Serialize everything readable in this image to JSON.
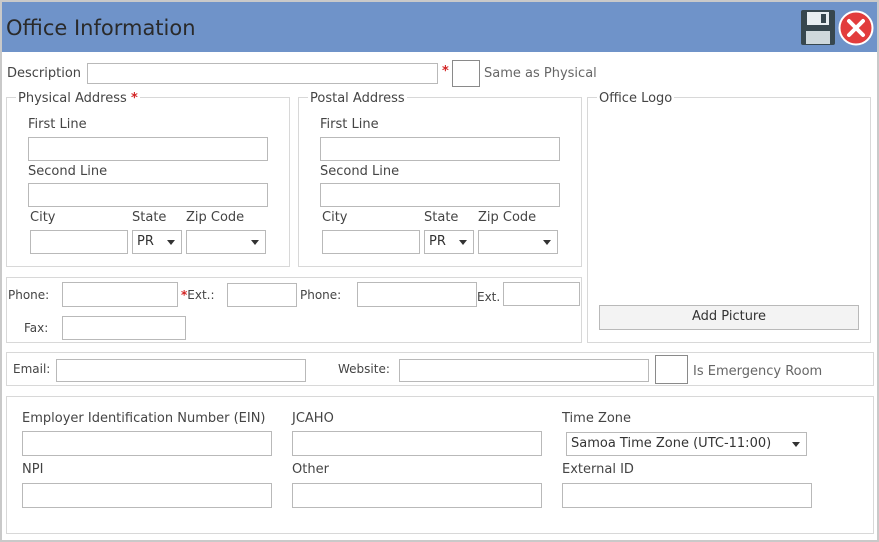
{
  "window": {
    "title": "Office Information"
  },
  "toolbar": {
    "save_icon": "floppy-disk-icon",
    "close_icon": "close-circle-icon"
  },
  "colors": {
    "titlebar": "#6f93c9",
    "required": "#d32424",
    "close": "#e23c3c"
  },
  "description": {
    "label": "Description",
    "value": "",
    "required_mark": "*",
    "same_as_physical_label": "Same as Physical"
  },
  "physical_address": {
    "legend": "Physical Address",
    "required_mark": "*",
    "first_line_label": "First Line",
    "first_line_value": "",
    "second_line_label": "Second Line",
    "second_line_value": "",
    "city_label": "City",
    "city_value": "",
    "state_label": "State",
    "state_value": "PR",
    "zip_label": "Zip Code",
    "zip_value": ""
  },
  "postal_address": {
    "legend": "Postal Address",
    "first_line_label": "First Line",
    "first_line_value": "",
    "second_line_label": "Second Line",
    "second_line_value": "",
    "city_label": "City",
    "city_value": "",
    "state_label": "State",
    "state_value": "PR",
    "zip_label": "Zip Code",
    "zip_value": ""
  },
  "office_logo": {
    "legend": "Office Logo",
    "add_picture_label": "Add Picture"
  },
  "contact": {
    "phone_label": "Phone:",
    "phone_value": "",
    "ext_required_mark": "*",
    "ext_label": "Ext.:",
    "ext_value": "",
    "phone2_label": "Phone:",
    "phone2_value": "",
    "ext2_label": "Ext.",
    "ext2_value": "",
    "fax_label": "Fax:",
    "fax_value": ""
  },
  "web": {
    "email_label": "Email:",
    "email_value": "",
    "website_label": "Website:",
    "website_value": "",
    "emergency_label": "Is Emergency Room"
  },
  "identifiers": {
    "ein_label": "Employer Identification Number (EIN)",
    "ein_value": "",
    "jcaho_label": "JCAHO",
    "jcaho_value": "",
    "timezone_label": "Time Zone",
    "timezone_value": "Samoa Time Zone (UTC-11:00)",
    "npi_label": "NPI",
    "npi_value": "",
    "other_label": "Other",
    "other_value": "",
    "external_id_label": "External ID",
    "external_id_value": ""
  }
}
